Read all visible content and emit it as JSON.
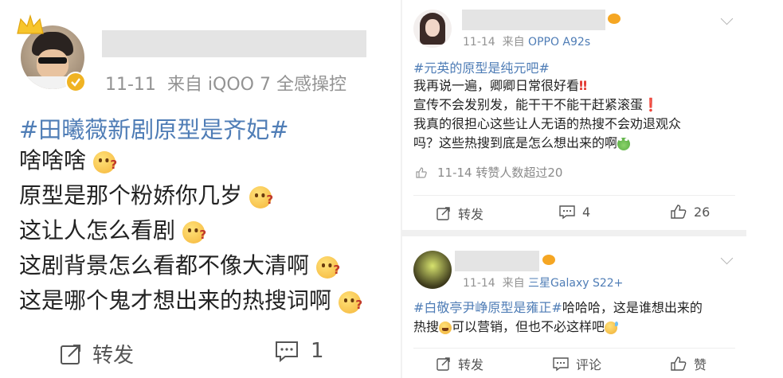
{
  "left_post": {
    "date": "11-11",
    "source": "来自 iQOO 7 全感操控",
    "hashtag": "#田曦薇新剧原型是齐妃#",
    "lines": [
      "啥啥啥",
      "原型是那个粉娇你几岁",
      "这让人怎么看剧",
      "这剧背景怎么看都不像大清啊",
      "这是哪个鬼才想出来的热搜词啊"
    ],
    "repost_label": "转发",
    "comment_count": "1"
  },
  "right_post_1": {
    "date": "11-14",
    "source_prefix": "来自",
    "source_device": "OPPO A92s",
    "hashtag": "#元英的原型是纯元吧#",
    "lines": [
      "我再说一遍，卿卿日常很好看",
      "宣传不会发别发，能干干不能干赶紧滚蛋",
      "我真的很担心这些让人无语的热搜不会劝退观众",
      "吗？这些热搜到底是怎么想出来的啊"
    ],
    "repost_info": "11-14 转赞人数超过20",
    "repost_label": "转发",
    "comment_count": "4",
    "like_count": "26"
  },
  "right_post_2": {
    "date": "11-14",
    "source_prefix": "来自",
    "source_device": "三星Galaxy S22+",
    "hashtag": "#白敬亭尹峥原型是雍正#",
    "line1_rest": "哈哈哈，这是谁想出来的",
    "line2_a": "热搜",
    "line2_b": "可以营销，但也不必这样吧",
    "repost_label": "转发",
    "comment_label": "评论",
    "like_label": "赞"
  },
  "colors": {
    "hashtag": "#4f7db6",
    "meta": "#939393",
    "verified": "#f0b323",
    "exclaim": "#e2362f"
  },
  "icons": [
    "crown-icon",
    "verified-badge-icon",
    "chevron-down-icon",
    "repost-icon",
    "comment-icon",
    "like-icon",
    "fan-badge-icon"
  ]
}
